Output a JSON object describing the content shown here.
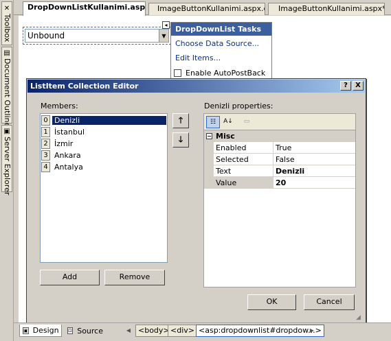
{
  "side_tabs": [
    {
      "icon": "toolbox-icon",
      "label": "Toolbox"
    },
    {
      "icon": "document-outline-icon",
      "label": "Document Outline"
    },
    {
      "icon": "server-explorer-icon",
      "label": "Server Explorer"
    }
  ],
  "doc_tabs": [
    {
      "label": "DropDownListKullanimi.aspx*",
      "active": true
    },
    {
      "label": "ImageButtonKullanimi.aspx.cs",
      "active": false
    },
    {
      "label": "ImageButtonKullanimi.aspx*",
      "active": false
    }
  ],
  "dropdown": {
    "value": "Unbound"
  },
  "tasks": {
    "title": "DropDownList Tasks",
    "choose_data_source": "Choose Data Source...",
    "edit_items": "Edit Items...",
    "autopostback_label": "Enable AutoPostBack",
    "autopostback_checked": false
  },
  "dialog": {
    "title": "ListItem Collection Editor",
    "help_btn": "?",
    "close_btn": "X",
    "members_label": "Members:",
    "members": [
      {
        "index": "0",
        "name": "Denizli",
        "selected": true
      },
      {
        "index": "1",
        "name": "İstanbul",
        "selected": false
      },
      {
        "index": "2",
        "name": "İzmir",
        "selected": false
      },
      {
        "index": "3",
        "name": "Ankara",
        "selected": false
      },
      {
        "index": "4",
        "name": "Antalya",
        "selected": false
      }
    ],
    "add_label": "Add",
    "remove_label": "Remove",
    "properties_label": "Denizli properties:",
    "category": "Misc",
    "properties": [
      {
        "name": "Enabled",
        "value": "True",
        "bold": false
      },
      {
        "name": "Selected",
        "value": "False",
        "bold": false
      },
      {
        "name": "Text",
        "value": "Denizli",
        "bold": true
      },
      {
        "name": "Value",
        "value": "20",
        "bold": true
      }
    ],
    "ok_label": "OK",
    "cancel_label": "Cancel"
  },
  "bottom": {
    "design_label": "Design",
    "source_label": "Source",
    "crumbs": [
      "<body>",
      "<div>",
      "<asp:dropdownlist#dropdow...>"
    ]
  }
}
